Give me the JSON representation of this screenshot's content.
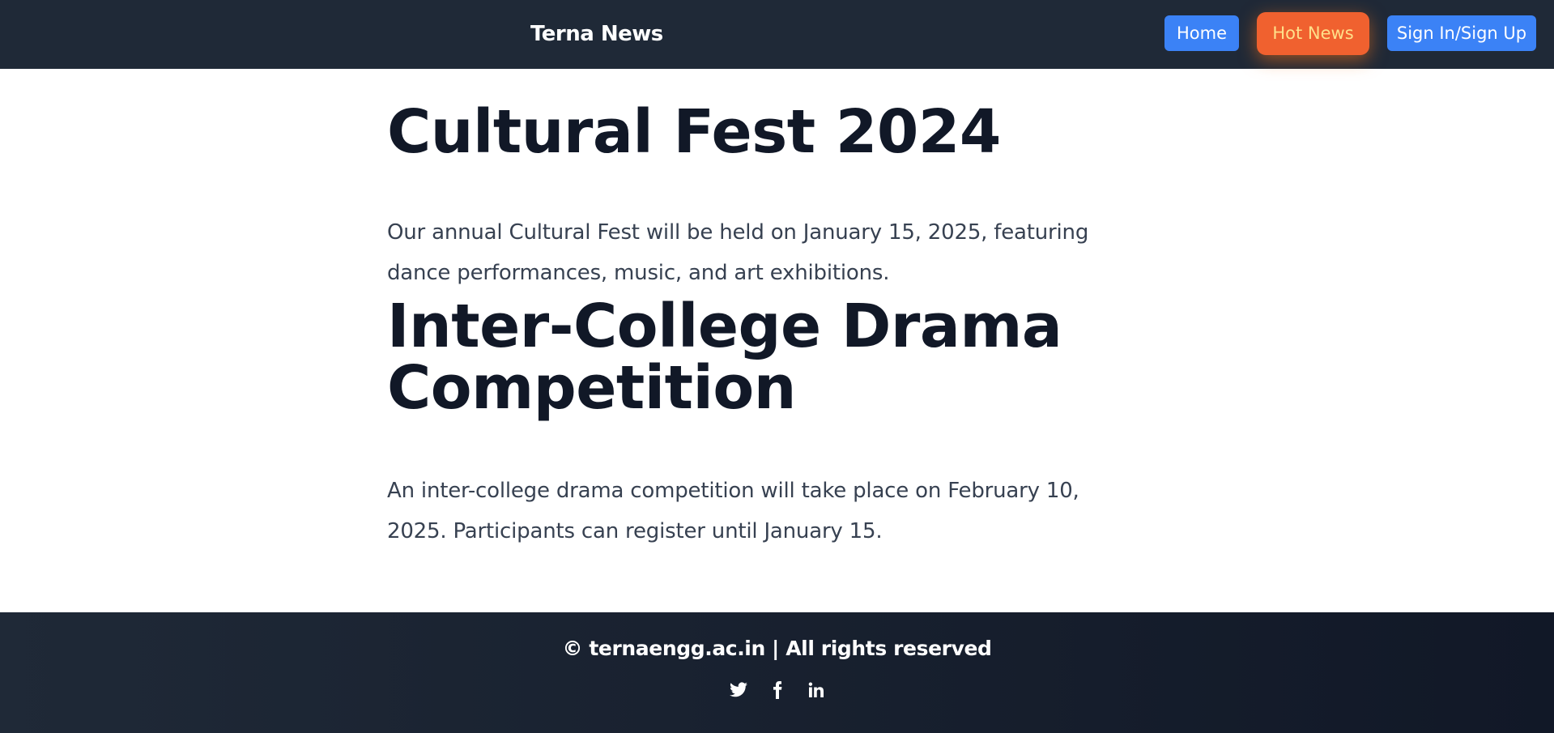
{
  "header": {
    "brand": "Terna News",
    "nav": {
      "home": "Home",
      "hot_news": "Hot News",
      "sign_in": "Sign In/Sign Up"
    }
  },
  "articles": [
    {
      "title": "Cultural Fest 2024",
      "body": "Our annual Cultural Fest will be held on January 15, 2025, featuring dance performances, music, and art exhibitions."
    },
    {
      "title": "Inter-College Drama Competition",
      "body": "An inter-college drama competition will take place on February 10, 2025. Participants can register until January 15."
    }
  ],
  "footer": {
    "copyright": "© ternaengg.ac.in | All rights reserved",
    "social_icons": [
      "twitter-icon",
      "facebook-icon",
      "linkedin-icon"
    ]
  },
  "colors": {
    "navbar": "#1f2937",
    "primary_button": "#3b82f6",
    "hot_news_button": "#f0612f",
    "hot_news_text": "#ffe08a",
    "heading": "#111827",
    "body_text": "#374151"
  }
}
